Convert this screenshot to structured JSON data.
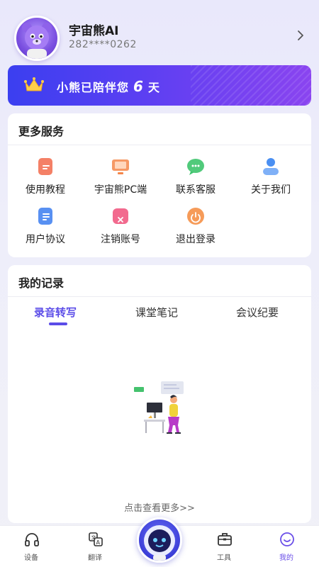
{
  "profile": {
    "name": "宇宙熊AI",
    "phone": "282****0262"
  },
  "banner": {
    "prefix": "小熊已陪伴您",
    "days": "6",
    "suffix": "天"
  },
  "services": {
    "title": "更多服务",
    "items": [
      {
        "label": "使用教程",
        "icon": "tutorial-icon",
        "color": "#f26a4b"
      },
      {
        "label": "宇宙熊PC端",
        "icon": "pc-client-icon",
        "color": "#f5874a"
      },
      {
        "label": "联系客服",
        "icon": "customer-service-icon",
        "color": "#3ec46d"
      },
      {
        "label": "关于我们",
        "icon": "about-us-icon",
        "color": "#4a8ff2"
      },
      {
        "label": "用户协议",
        "icon": "user-agreement-icon",
        "color": "#3b7cf0"
      },
      {
        "label": "注销账号",
        "icon": "delete-account-icon",
        "color": "#f0507a"
      },
      {
        "label": "退出登录",
        "icon": "logout-icon",
        "color": "#f58a3c"
      }
    ]
  },
  "records": {
    "title": "我的记录",
    "tabs": [
      "录音转写",
      "课堂笔记",
      "会议纪要"
    ],
    "active_tab": "录音转写",
    "see_more": "点击查看更多>>"
  },
  "nav": {
    "items": [
      {
        "label": "设备",
        "icon": "headphones-icon"
      },
      {
        "label": "翻译",
        "icon": "translate-icon"
      },
      {
        "label": "工具",
        "icon": "toolbox-icon"
      },
      {
        "label": "我的",
        "icon": "smiley-icon"
      }
    ],
    "active": "我的"
  },
  "colors": {
    "accent": "#5b4ce8",
    "banner_start": "#3b3ff0",
    "banner_end": "#8a44f0"
  }
}
